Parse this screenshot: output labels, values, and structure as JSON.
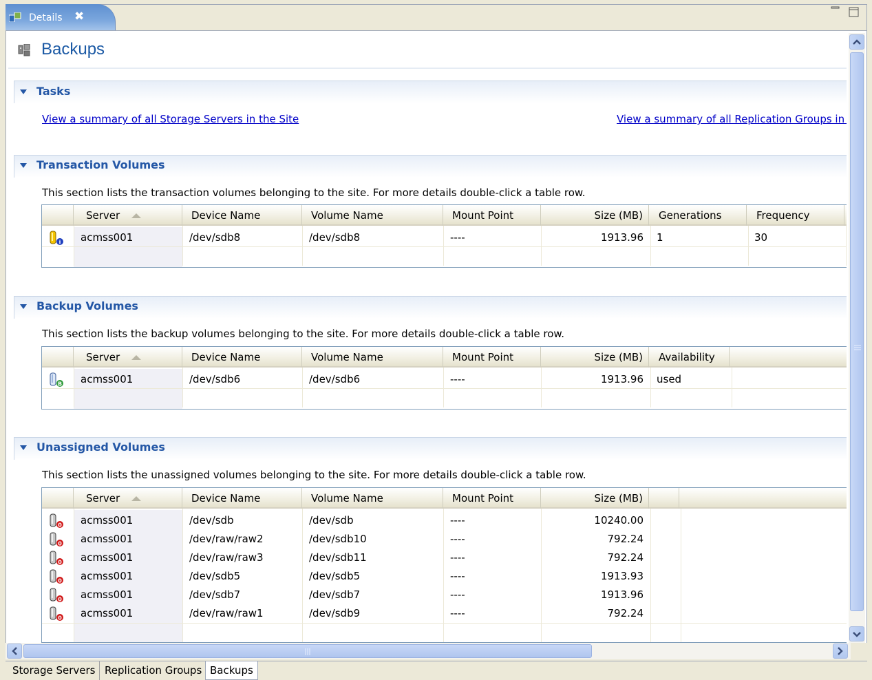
{
  "view_tab": {
    "label": "Details",
    "close": "✖"
  },
  "page": {
    "title": "Backups"
  },
  "tasks": {
    "title": "Tasks",
    "link_storage": "View a summary of all Storage Servers in the Site",
    "link_replication": "View a summary of all Replication Groups in t"
  },
  "transaction": {
    "title": "Transaction Volumes",
    "description": "This section lists the transaction volumes belonging to the site. For more details double-click a table row.",
    "headers": [
      "Server",
      "Device Name",
      "Volume Name",
      "Mount Point",
      "Size (MB)",
      "Generations",
      "Frequency"
    ],
    "rows": [
      {
        "server": "acmss001",
        "device": "/dev/sdb8",
        "volume": "/dev/sdb8",
        "mount": "----",
        "size": "1913.96",
        "generations": "1",
        "frequency": "30"
      }
    ]
  },
  "backup": {
    "title": "Backup Volumes",
    "description": "This section lists the backup volumes belonging to the site. For more details double-click a table row.",
    "headers": [
      "Server",
      "Device Name",
      "Volume Name",
      "Mount Point",
      "Size (MB)",
      "Availability"
    ],
    "rows": [
      {
        "server": "acmss001",
        "device": "/dev/sdb6",
        "volume": "/dev/sdb6",
        "mount": "----",
        "size": "1913.96",
        "availability": "used"
      }
    ]
  },
  "unassigned": {
    "title": "Unassigned Volumes",
    "description": "This section lists the unassigned volumes belonging to the site. For more details double-click a table row.",
    "headers": [
      "Server",
      "Device Name",
      "Volume Name",
      "Mount Point",
      "Size (MB)"
    ],
    "rows": [
      {
        "server": "acmss001",
        "device": "/dev/sdb",
        "volume": "/dev/sdb",
        "mount": "----",
        "size": "10240.00"
      },
      {
        "server": "acmss001",
        "device": "/dev/raw/raw2",
        "volume": "/dev/sdb10",
        "mount": "----",
        "size": "792.24"
      },
      {
        "server": "acmss001",
        "device": "/dev/raw/raw3",
        "volume": "/dev/sdb11",
        "mount": "----",
        "size": "792.24"
      },
      {
        "server": "acmss001",
        "device": "/dev/sdb5",
        "volume": "/dev/sdb5",
        "mount": "----",
        "size": "1913.93"
      },
      {
        "server": "acmss001",
        "device": "/dev/sdb7",
        "volume": "/dev/sdb7",
        "mount": "----",
        "size": "1913.96"
      },
      {
        "server": "acmss001",
        "device": "/dev/raw/raw1",
        "volume": "/dev/sdb9",
        "mount": "----",
        "size": "792.24"
      }
    ]
  },
  "bottom_tabs": [
    "Storage Servers",
    "Replication Groups",
    "Backups"
  ],
  "colors": {
    "section_title": "#2457a6",
    "link": "#0000c8",
    "page_title": "#1c5aa5"
  },
  "icons": {
    "transaction_volume": "volume-info-icon",
    "backup_volume": "volume-backup-icon",
    "unassigned_volume": "volume-error-icon"
  }
}
